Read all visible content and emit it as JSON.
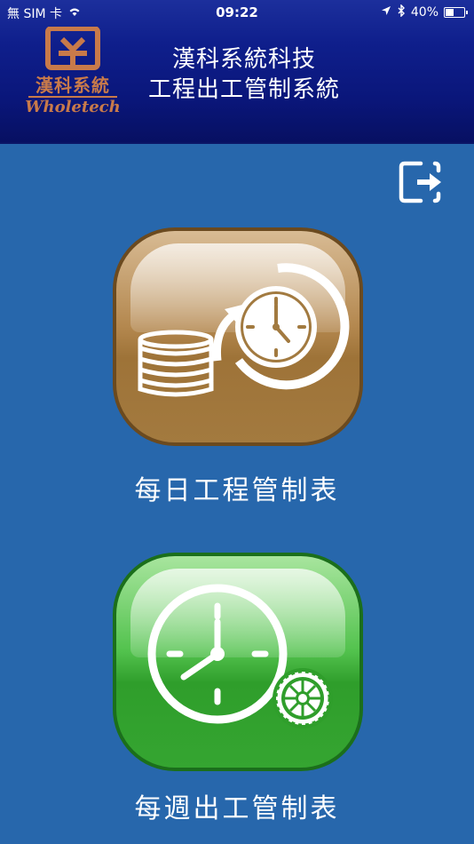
{
  "status_bar": {
    "carrier": "無 SIM 卡",
    "time": "09:22",
    "battery": "40%"
  },
  "header": {
    "logo_text": "漢科系統",
    "logo_sub": "Wholetech",
    "title_line1": "漢科系統科技",
    "title_line2": "工程出工管制系統"
  },
  "actions": {
    "logout_icon": "logout-icon"
  },
  "menu": {
    "daily": {
      "label": "每日工程管制表",
      "color": "#b08547"
    },
    "weekly": {
      "label": "每週出工管制表",
      "color": "#3aa836"
    }
  },
  "colors": {
    "background": "#2767ac",
    "header": "#0f1f8c",
    "logo": "#c87a4a"
  }
}
